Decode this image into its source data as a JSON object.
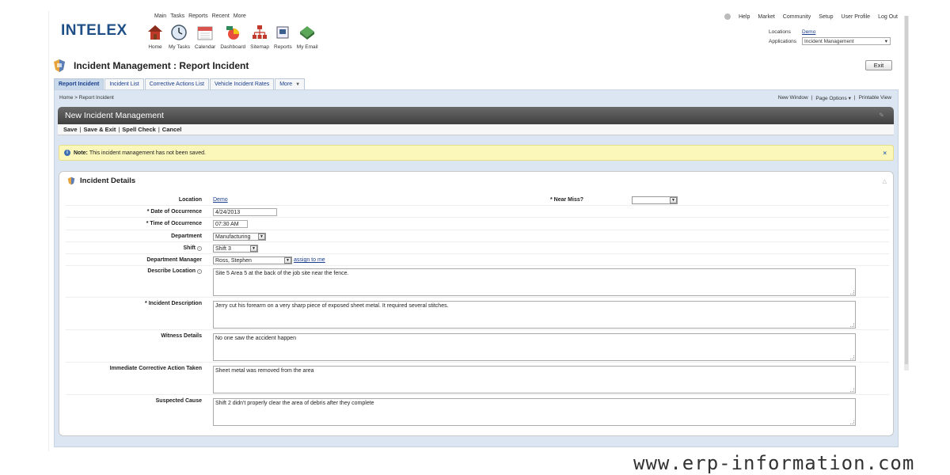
{
  "top_menu": [
    "Main",
    "Tasks",
    "Reports",
    "Recent",
    "More"
  ],
  "right_links": [
    "Help",
    "Market",
    "Community",
    "Setup",
    "User Profile",
    "Log Out"
  ],
  "logo": "INTELEX",
  "toolbar_icons": [
    {
      "label": "Home",
      "icon": "home-icon"
    },
    {
      "label": "My Tasks",
      "icon": "tasks-icon"
    },
    {
      "label": "Calendar",
      "icon": "calendar-icon"
    },
    {
      "label": "Dashboard",
      "icon": "dashboard-icon"
    },
    {
      "label": "Sitemap",
      "icon": "sitemap-icon"
    },
    {
      "label": "Reports",
      "icon": "reports-icon"
    },
    {
      "label": "My Email",
      "icon": "email-icon"
    }
  ],
  "locations": {
    "label": "Locations",
    "value": "Demo"
  },
  "applications": {
    "label": "Applications",
    "value": "Incident Management"
  },
  "page_title": "Incident Management : Report Incident",
  "exit_label": "Exit",
  "tabs": [
    {
      "label": "Report Incident",
      "active": true
    },
    {
      "label": "Incident List"
    },
    {
      "label": "Corrective Actions List"
    },
    {
      "label": "Vehicle Incident Rates"
    },
    {
      "label": "More"
    }
  ],
  "breadcrumb": "Home > Report Incident",
  "page_options": {
    "new_window": "New Window",
    "page_options": "Page Options",
    "printable_view": "Printable View"
  },
  "section_title": "New Incident Management",
  "actions": {
    "save": "Save",
    "save_exit": "Save & Exit",
    "spell_check": "Spell Check",
    "cancel": "Cancel"
  },
  "note": {
    "label": "Note:",
    "text": "This incident management has not been saved."
  },
  "details_title": "Incident Details",
  "fields": {
    "location": {
      "label": "Location",
      "value": "Demo"
    },
    "near_miss": {
      "label": "* Near Miss?",
      "value": ""
    },
    "date": {
      "label": "* Date of Occurrence",
      "value": "4/24/2013"
    },
    "time": {
      "label": "* Time of Occurrence",
      "value": "07:30 AM"
    },
    "department": {
      "label": "Department",
      "value": "Manufacturing"
    },
    "shift": {
      "label": "Shift",
      "value": "Shift 3"
    },
    "manager": {
      "label": "Department Manager",
      "value": "Ross, Stephen",
      "assign": "assign to me"
    },
    "describe_location": {
      "label": "Describe Location",
      "value": "Site 5 Area 5 at the back of the job site near the fence."
    },
    "incident_description": {
      "label": "* Incident Description",
      "value": "Jerry cut his forearm on a very sharp piece of exposed sheet metal. It required several stitches."
    },
    "witness": {
      "label": "Witness Details",
      "value": "No one saw the accident happen"
    },
    "corrective": {
      "label": "Immediate Corrective Action Taken",
      "value": "Sheet metal was removed from the area"
    },
    "cause": {
      "label": "Suspected Cause",
      "value": "Shift 2 didn't properly clear the area of debris after they complete"
    }
  },
  "watermark": "www.erp-information.com",
  "colors": {
    "brand": "#1e4f86",
    "tab_active": "#c8d9ec",
    "note_bg": "#fbf7ba",
    "dark_bar": "#4a4a4a"
  }
}
